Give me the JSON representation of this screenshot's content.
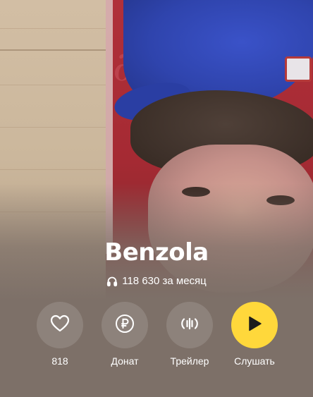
{
  "artist": {
    "name": "Benzola",
    "listeners": "118 630 за месяц",
    "listeners_icon": "headphones-icon"
  },
  "actions": [
    {
      "id": "like",
      "label": "818",
      "icon": "heart-icon"
    },
    {
      "id": "donate",
      "label": "Донат",
      "icon": "ruble-icon"
    },
    {
      "id": "trailer",
      "label": "Трейлер",
      "icon": "waveform-icon"
    },
    {
      "id": "play",
      "label": "Слушать",
      "icon": "play-icon"
    }
  ],
  "colors": {
    "play_button": "#ffd83b",
    "background": "#7d7068",
    "text": "#ffffff"
  }
}
